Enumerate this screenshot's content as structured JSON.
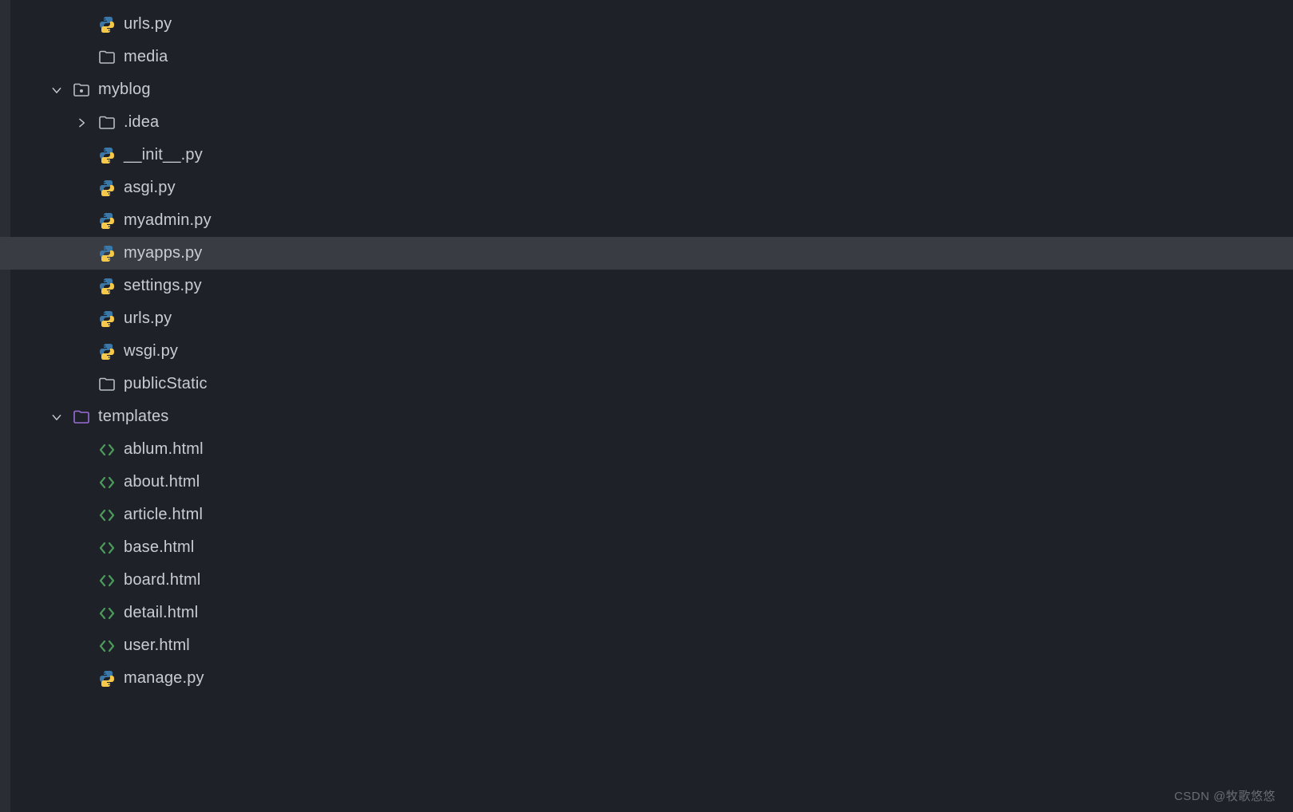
{
  "tree": [
    {
      "depth": 2,
      "icon": "python",
      "label": "urls.py",
      "selected": false
    },
    {
      "depth": 1,
      "icon": "folder",
      "label": "media",
      "selected": false
    },
    {
      "depth": 0,
      "icon": "folder-dot",
      "label": "myblog",
      "selected": false,
      "arrow": "down"
    },
    {
      "depth": 1,
      "icon": "folder",
      "label": ".idea",
      "selected": false,
      "arrow": "right"
    },
    {
      "depth": 2,
      "icon": "python",
      "label": "__init__.py",
      "selected": false
    },
    {
      "depth": 2,
      "icon": "python",
      "label": "asgi.py",
      "selected": false
    },
    {
      "depth": 2,
      "icon": "python",
      "label": "myadmin.py",
      "selected": false
    },
    {
      "depth": 2,
      "icon": "python",
      "label": "myapps.py",
      "selected": true
    },
    {
      "depth": 2,
      "icon": "python",
      "label": "settings.py",
      "selected": false
    },
    {
      "depth": 2,
      "icon": "python",
      "label": "urls.py",
      "selected": false
    },
    {
      "depth": 2,
      "icon": "python",
      "label": "wsgi.py",
      "selected": false
    },
    {
      "depth": 1,
      "icon": "folder",
      "label": "publicStatic",
      "selected": false
    },
    {
      "depth": 0,
      "icon": "folder-tpl",
      "label": "templates",
      "selected": false,
      "arrow": "down"
    },
    {
      "depth": 2,
      "icon": "html",
      "label": "ablum.html",
      "selected": false
    },
    {
      "depth": 2,
      "icon": "html",
      "label": "about.html",
      "selected": false
    },
    {
      "depth": 2,
      "icon": "html",
      "label": "article.html",
      "selected": false
    },
    {
      "depth": 2,
      "icon": "html",
      "label": "base.html",
      "selected": false
    },
    {
      "depth": 2,
      "icon": "html",
      "label": "board.html",
      "selected": false
    },
    {
      "depth": 2,
      "icon": "html",
      "label": "detail.html",
      "selected": false
    },
    {
      "depth": 2,
      "icon": "html",
      "label": "user.html",
      "selected": false
    },
    {
      "depth": 1,
      "icon": "python",
      "label": "manage.py",
      "selected": false
    }
  ],
  "watermark": "CSDN @牧歌悠悠"
}
